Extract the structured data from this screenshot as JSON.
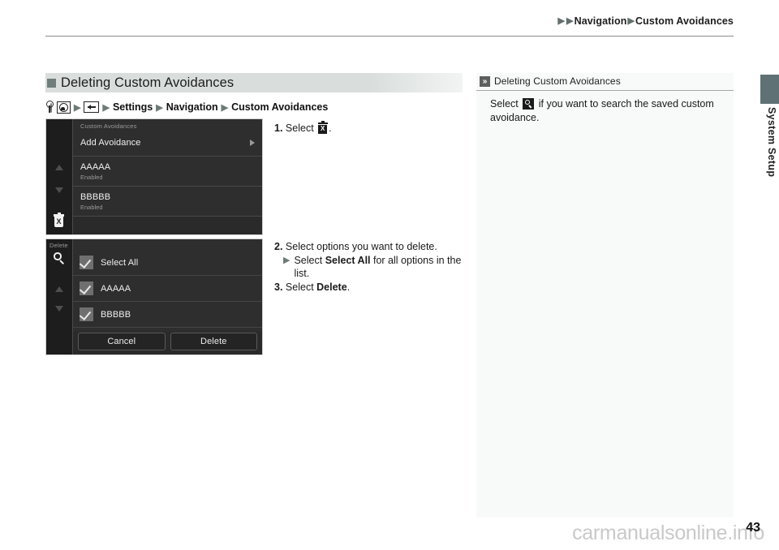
{
  "header": {
    "breadcrumb": [
      "Navigation",
      "Custom Avoidances"
    ],
    "triangle": "▶"
  },
  "edge_tab": {
    "label": "System Setup",
    "color": "#5f7174"
  },
  "section": {
    "title": "Deleting Custom Avoidances",
    "bullet_color": "#707e7b",
    "path": [
      "Settings",
      "Navigation",
      "Custom Avoidances"
    ],
    "path_icons": [
      "key-icon",
      "menu-button-icon",
      "back-button-icon"
    ]
  },
  "screenshot_1": {
    "title": "Custom Avoidances",
    "rows": [
      {
        "primary": "Add Avoidance",
        "secondary": "",
        "chevron": true
      },
      {
        "primary": "AAAAA",
        "secondary": "Enabled",
        "chevron": false
      },
      {
        "primary": "BBBBB",
        "secondary": "Enabled",
        "chevron": false
      }
    ],
    "rail_icons": [
      "arrow-up-icon",
      "arrow-down-icon",
      "trash-icon"
    ],
    "trash_glyph": "X"
  },
  "screenshot_2": {
    "title": "Delete",
    "rows": [
      {
        "label": "Select All",
        "checked": true
      },
      {
        "label": "AAAAA",
        "checked": true
      },
      {
        "label": "BBBBB",
        "checked": true
      }
    ],
    "buttons": [
      {
        "label": "Cancel"
      },
      {
        "label": "Delete"
      }
    ],
    "rail_icons": [
      "search-icon",
      "arrow-up-icon",
      "arrow-down-icon"
    ]
  },
  "steps": {
    "step1": {
      "num": "1.",
      "text_before": "Select",
      "icon": "trash-icon",
      "text_after": "."
    },
    "step2": {
      "num": "2.",
      "text": "Select options you want to delete."
    },
    "step2_sub": {
      "bullet": "▶",
      "before": "Select",
      "bold": "Select All",
      "after": "for all options in the list."
    },
    "step3": {
      "num": "3.",
      "before": "Select",
      "bold": "Delete",
      "after": "."
    }
  },
  "note": {
    "chevron": "»",
    "title": "Deleting Custom Avoidances",
    "text_before": "Select",
    "icon": "search-icon",
    "text_after": "if you want to search the saved custom avoidance."
  },
  "footer": {
    "page_number": "43",
    "watermark": "carmanualsonline.info"
  }
}
